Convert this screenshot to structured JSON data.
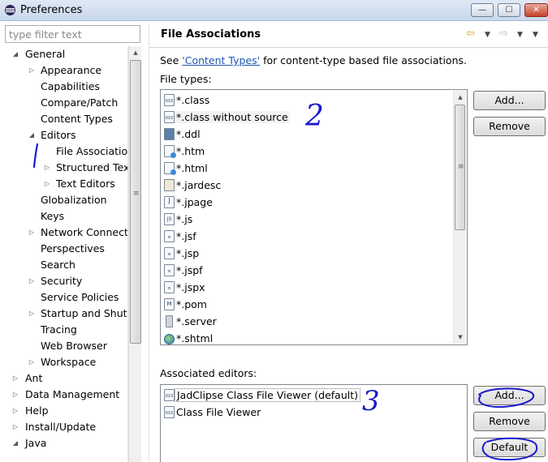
{
  "window": {
    "title": "Preferences",
    "controls": {
      "minimize": "—",
      "maximize": "☐",
      "close": "✕"
    }
  },
  "sidebar": {
    "filter_placeholder": "type filter text",
    "tree": [
      {
        "label": "General",
        "level": 0,
        "state": "expanded"
      },
      {
        "label": "Appearance",
        "level": 1,
        "state": "collapsed"
      },
      {
        "label": "Capabilities",
        "level": 1,
        "state": "leaf"
      },
      {
        "label": "Compare/Patch",
        "level": 1,
        "state": "leaf"
      },
      {
        "label": "Content Types",
        "level": 1,
        "state": "leaf"
      },
      {
        "label": "Editors",
        "level": 1,
        "state": "expanded"
      },
      {
        "label": "File Associations",
        "level": 2,
        "state": "leaf",
        "selected": true
      },
      {
        "label": "Structured Text Editors",
        "level": 2,
        "state": "collapsed"
      },
      {
        "label": "Text Editors",
        "level": 2,
        "state": "collapsed"
      },
      {
        "label": "Globalization",
        "level": 1,
        "state": "leaf"
      },
      {
        "label": "Keys",
        "level": 1,
        "state": "leaf"
      },
      {
        "label": "Network Connections",
        "level": 1,
        "state": "collapsed"
      },
      {
        "label": "Perspectives",
        "level": 1,
        "state": "leaf"
      },
      {
        "label": "Search",
        "level": 1,
        "state": "leaf"
      },
      {
        "label": "Security",
        "level": 1,
        "state": "collapsed"
      },
      {
        "label": "Service Policies",
        "level": 1,
        "state": "leaf"
      },
      {
        "label": "Startup and Shutdown",
        "level": 1,
        "state": "collapsed"
      },
      {
        "label": "Tracing",
        "level": 1,
        "state": "leaf"
      },
      {
        "label": "Web Browser",
        "level": 1,
        "state": "leaf"
      },
      {
        "label": "Workspace",
        "level": 1,
        "state": "collapsed"
      },
      {
        "label": "Ant",
        "level": 0,
        "state": "collapsed"
      },
      {
        "label": "Data Management",
        "level": 0,
        "state": "collapsed"
      },
      {
        "label": "Help",
        "level": 0,
        "state": "collapsed"
      },
      {
        "label": "Install/Update",
        "level": 0,
        "state": "collapsed"
      },
      {
        "label": "Java",
        "level": 0,
        "state": "expanded"
      }
    ]
  },
  "page": {
    "title": "File Associations",
    "see_prefix": "See ",
    "see_link": "'Content Types'",
    "see_suffix": " for content-type based file associations.",
    "file_types_label": "File types:",
    "file_types": [
      {
        "label": "*.class",
        "icon": "class-file-icon"
      },
      {
        "label": "*.class without source",
        "icon": "class-file-icon",
        "selected": true
      },
      {
        "label": "*.ddl",
        "icon": "ddl-file-icon"
      },
      {
        "label": "*.htm",
        "icon": "html-file-icon"
      },
      {
        "label": "*.html",
        "icon": "html-file-icon"
      },
      {
        "label": "*.jardesc",
        "icon": "jardesc-file-icon"
      },
      {
        "label": "*.jpage",
        "icon": "jpage-file-icon"
      },
      {
        "label": "*.js",
        "icon": "js-file-icon"
      },
      {
        "label": "*.jsf",
        "icon": "text-file-icon"
      },
      {
        "label": "*.jsp",
        "icon": "text-file-icon"
      },
      {
        "label": "*.jspf",
        "icon": "text-file-icon"
      },
      {
        "label": "*.jspx",
        "icon": "text-file-icon"
      },
      {
        "label": "*.pom",
        "icon": "pom-file-icon"
      },
      {
        "label": "*.server",
        "icon": "server-file-icon"
      },
      {
        "label": "*.shtml",
        "icon": "globe-file-icon"
      }
    ],
    "file_type_buttons": {
      "add": "Add...",
      "remove": "Remove"
    },
    "editors_label": "Associated editors:",
    "editors": [
      {
        "label": "JadClipse Class File Viewer (default)",
        "icon": "class-file-icon",
        "selected": true
      },
      {
        "label": "Class File Viewer",
        "icon": "class-file-icon"
      }
    ],
    "editor_buttons": {
      "add": "Add...",
      "remove": "Remove",
      "default": "Default"
    }
  },
  "annotations": {
    "one": "1",
    "two": "2",
    "three": "3"
  },
  "colors": {
    "ink": "#1a1acc",
    "link": "#1b57b1",
    "title_bar": "#c9d8ec"
  }
}
